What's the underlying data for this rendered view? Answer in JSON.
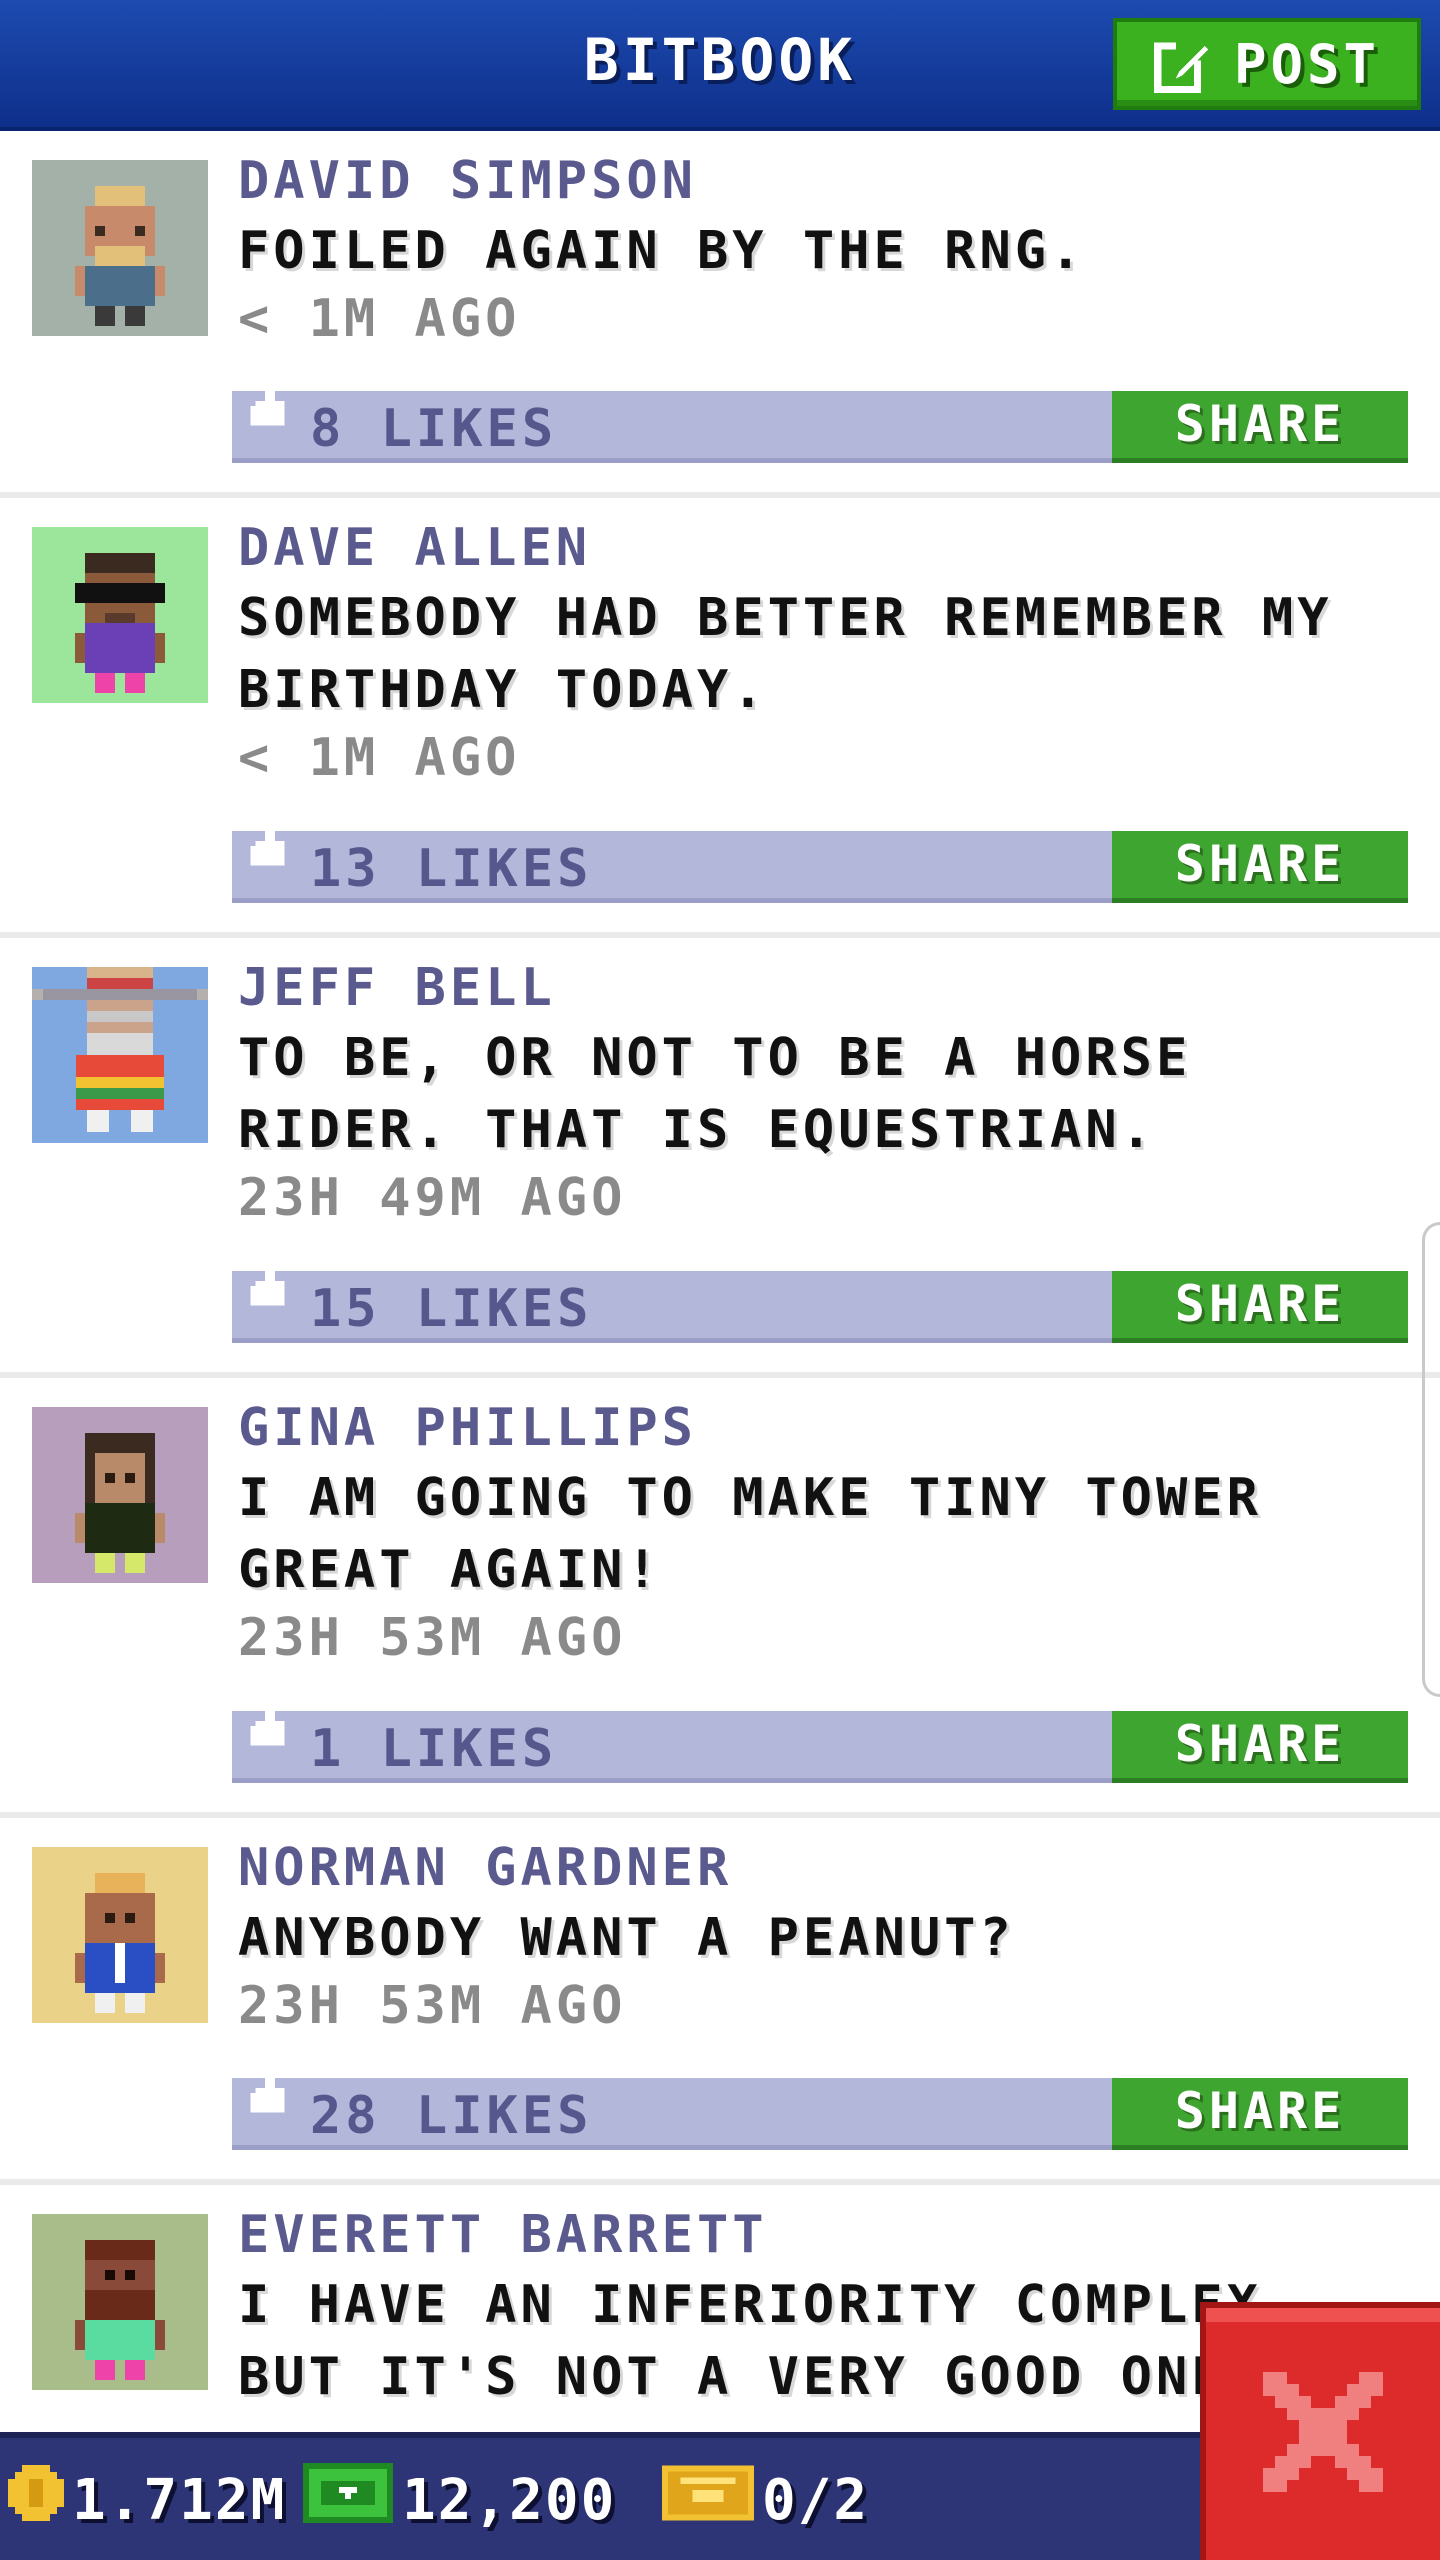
{
  "header": {
    "title": "BITBOOK",
    "post_label": "POST"
  },
  "posts": [
    {
      "name": "DAVID SIMPSON",
      "text": "FOILED AGAIN BY THE RNG.",
      "time": "< 1M AGO",
      "likes": "8 LIKES",
      "share_label": "SHARE",
      "avatar_bg": "#a3b1a9"
    },
    {
      "name": "DAVE ALLEN",
      "text": "SOMEBODY HAD BETTER REMEMBER MY BIRTHDAY TODAY.",
      "time": "< 1M AGO",
      "likes": "13 LIKES",
      "share_label": "SHARE",
      "avatar_bg": "#9be69b"
    },
    {
      "name": "JEFF BELL",
      "text": "TO BE, OR NOT TO BE A HORSE RIDER. THAT IS EQUESTRIAN.",
      "time": "23H 49M AGO",
      "likes": "15 LIKES",
      "share_label": "SHARE",
      "avatar_bg": "#7fa8e0"
    },
    {
      "name": "GINA PHILLIPS",
      "text": "I AM GOING TO MAKE TINY TOWER GREAT AGAIN!",
      "time": "23H 53M AGO",
      "likes": "1 LIKES",
      "share_label": "SHARE",
      "avatar_bg": "#b79ebd"
    },
    {
      "name": "NORMAN GARDNER",
      "text": "ANYBODY WANT A PEANUT?",
      "time": "23H 53M AGO",
      "likes": "28 LIKES",
      "share_label": "SHARE",
      "avatar_bg": "#ead289"
    },
    {
      "name": "EVERETT BARRETT",
      "text": "I HAVE AN INFERIORITY COMPLEX, BUT IT'S NOT A VERY GOOD ONE...",
      "time": "",
      "likes": "",
      "share_label": "",
      "avatar_bg": "#a9bd8b"
    }
  ],
  "status_bar": {
    "coins": "1.712M",
    "bux": "12,200",
    "tickets": "0/2"
  },
  "colors": {
    "header": "#1d4bb0",
    "accent_green": "#3fa531",
    "likes_bar": "#b3b7d9",
    "name_text": "#5a5a8e",
    "close_red": "#dd2a2a"
  },
  "icons": [
    "edit-icon",
    "thumbs-up-icon",
    "coin-icon",
    "bux-icon",
    "ticket-icon",
    "close-icon"
  ]
}
